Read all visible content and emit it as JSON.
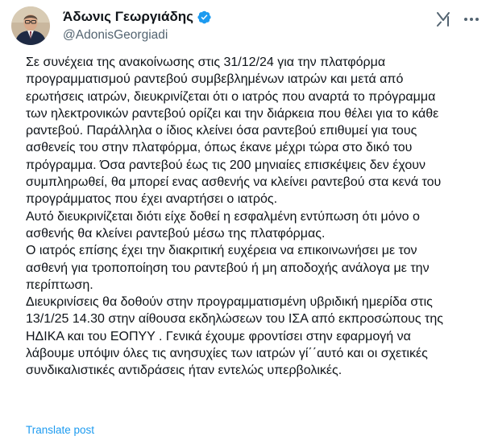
{
  "author": {
    "display_name": "Άδωνις Γεωργιάδης",
    "handle": "@AdonisGeorgiadi",
    "verified_icon": "verified-badge-icon",
    "avatar_icon": "avatar"
  },
  "actions": {
    "grok_icon": "grok-icon",
    "more_icon": "more-options-icon"
  },
  "post": {
    "lines": [
      "Σε συνέχεια της ανακοίνωσης στις 31/12/24 για την πλατφόρμα",
      "προγραμματισμού ραντεβού συμβεβλημένων ιατρών και μετά από",
      "ερωτήσεις ιατρών, διευκρινίζεται ότι ο ιατρός που αναρτά το πρόγραμμα",
      "των ηλεκτρονικών ραντεβού ορίζει και την διάρκεια που θέλει για το κάθε",
      "ραντεβού. Παράλληλα ο ίδιος κλείνει όσα ραντεβού επιθυμεί για τους",
      "ασθενείς του στην πλατφόρμα, όπως έκανε μέχρι τώρα  στο δικό του",
      "πρόγραμμα. Όσα ραντεβού έως τις 200 μηνιαίες επισκέψεις δεν έχουν",
      "συμπληρωθεί, θα μπορεί ενας ασθενής να κλείνει ραντεβού στα κενά του",
      "προγράμματος που έχει αναρτήσει ο ιατρός.",
      "Αυτό διευκρινίζεται διότι είχε δοθεί η εσφαλμένη εντύπωση ότι μόνο ο",
      "ασθενής θα κλείνει ραντεβού μέσω της πλατφόρμας.",
      "Ο ιατρός επίσης έχει την διακριτική ευχέρεια να επικοινωνήσει με τον",
      "ασθενή για τροποποίηση του ραντεβού ή μη αποδοχής ανάλογα με την",
      "περίπτωση.",
      "Διευκρινίσεις θα δοθούν στην προγραμματισμένη υβριδική ημερίδα στις",
      "13/1/25 14.30 στην αίθουσα εκδηλώσεων του ΙΣΑ από εκπροσώπους της",
      "ΗΔΙΚΑ και του ΕΟΠΥΥ . Γενικά έχουμε φροντίσει στην εφαρμογή να",
      "λάβουμε  υπόψιν όλες τις ανησυχίες των ιατρών γί΄΄αυτό και οι σχετικές",
      "συνδικαλιστικές αντιδράσεις ήταν εντελώς  υπερβολικές."
    ]
  },
  "footer": {
    "translate_label": "Translate post"
  },
  "colors": {
    "text": "#0f1419",
    "secondary": "#536471",
    "accent": "#1d9bf0"
  }
}
